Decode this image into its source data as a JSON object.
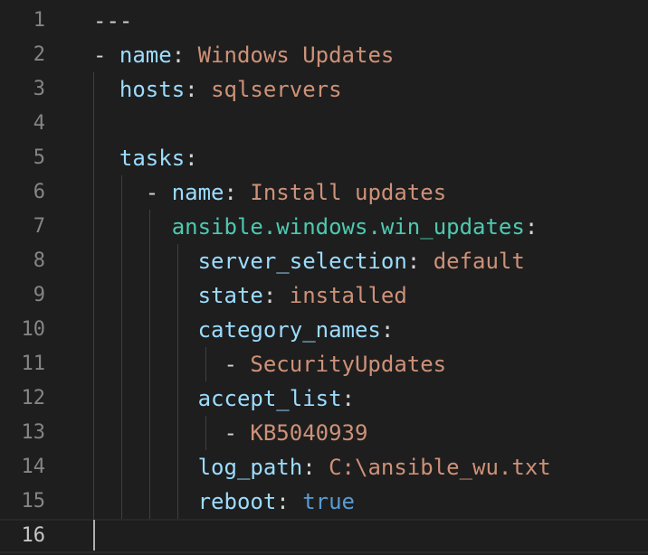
{
  "editor": {
    "lines": [
      {
        "num": "1",
        "tokens": [
          {
            "t": "---",
            "c": "t-plain"
          }
        ]
      },
      {
        "num": "2",
        "tokens": [
          {
            "t": "- ",
            "c": "t-plain"
          },
          {
            "t": "name",
            "c": "t-key2"
          },
          {
            "t": ": ",
            "c": "t-punc"
          },
          {
            "t": "Windows Updates",
            "c": "t-str"
          }
        ]
      },
      {
        "num": "3",
        "tokens": [
          {
            "t": "  ",
            "c": "t-plain"
          },
          {
            "t": "hosts",
            "c": "t-key2"
          },
          {
            "t": ": ",
            "c": "t-punc"
          },
          {
            "t": "sqlservers",
            "c": "t-str"
          }
        ]
      },
      {
        "num": "4",
        "tokens": []
      },
      {
        "num": "5",
        "tokens": [
          {
            "t": "  ",
            "c": "t-plain"
          },
          {
            "t": "tasks",
            "c": "t-key2"
          },
          {
            "t": ":",
            "c": "t-punc"
          }
        ]
      },
      {
        "num": "6",
        "tokens": [
          {
            "t": "    - ",
            "c": "t-plain"
          },
          {
            "t": "name",
            "c": "t-key2"
          },
          {
            "t": ": ",
            "c": "t-punc"
          },
          {
            "t": "Install updates",
            "c": "t-str"
          }
        ]
      },
      {
        "num": "7",
        "tokens": [
          {
            "t": "      ",
            "c": "t-plain"
          },
          {
            "t": "ansible.windows.win_updates",
            "c": "t-mod"
          },
          {
            "t": ":",
            "c": "t-punc"
          }
        ]
      },
      {
        "num": "8",
        "tokens": [
          {
            "t": "        ",
            "c": "t-plain"
          },
          {
            "t": "server_selection",
            "c": "t-key2"
          },
          {
            "t": ": ",
            "c": "t-punc"
          },
          {
            "t": "default",
            "c": "t-str"
          }
        ]
      },
      {
        "num": "9",
        "tokens": [
          {
            "t": "        ",
            "c": "t-plain"
          },
          {
            "t": "state",
            "c": "t-key2"
          },
          {
            "t": ": ",
            "c": "t-punc"
          },
          {
            "t": "installed",
            "c": "t-str"
          }
        ]
      },
      {
        "num": "10",
        "tokens": [
          {
            "t": "        ",
            "c": "t-plain"
          },
          {
            "t": "category_names",
            "c": "t-key2"
          },
          {
            "t": ":",
            "c": "t-punc"
          }
        ]
      },
      {
        "num": "11",
        "tokens": [
          {
            "t": "          - ",
            "c": "t-plain"
          },
          {
            "t": "SecurityUpdates",
            "c": "t-str"
          }
        ]
      },
      {
        "num": "12",
        "tokens": [
          {
            "t": "        ",
            "c": "t-plain"
          },
          {
            "t": "accept_list",
            "c": "t-key2"
          },
          {
            "t": ":",
            "c": "t-punc"
          }
        ]
      },
      {
        "num": "13",
        "tokens": [
          {
            "t": "          - ",
            "c": "t-plain"
          },
          {
            "t": "KB5040939",
            "c": "t-str"
          }
        ]
      },
      {
        "num": "14",
        "tokens": [
          {
            "t": "        ",
            "c": "t-plain"
          },
          {
            "t": "log_path",
            "c": "t-key2"
          },
          {
            "t": ": ",
            "c": "t-punc"
          },
          {
            "t": "C:\\ansible_wu.txt",
            "c": "t-str"
          }
        ]
      },
      {
        "num": "15",
        "tokens": [
          {
            "t": "        ",
            "c": "t-plain"
          },
          {
            "t": "reboot",
            "c": "t-key2"
          },
          {
            "t": ": ",
            "c": "t-punc"
          },
          {
            "t": "true",
            "c": "t-kw"
          }
        ]
      },
      {
        "num": "16",
        "tokens": []
      }
    ],
    "current_line": "16"
  }
}
